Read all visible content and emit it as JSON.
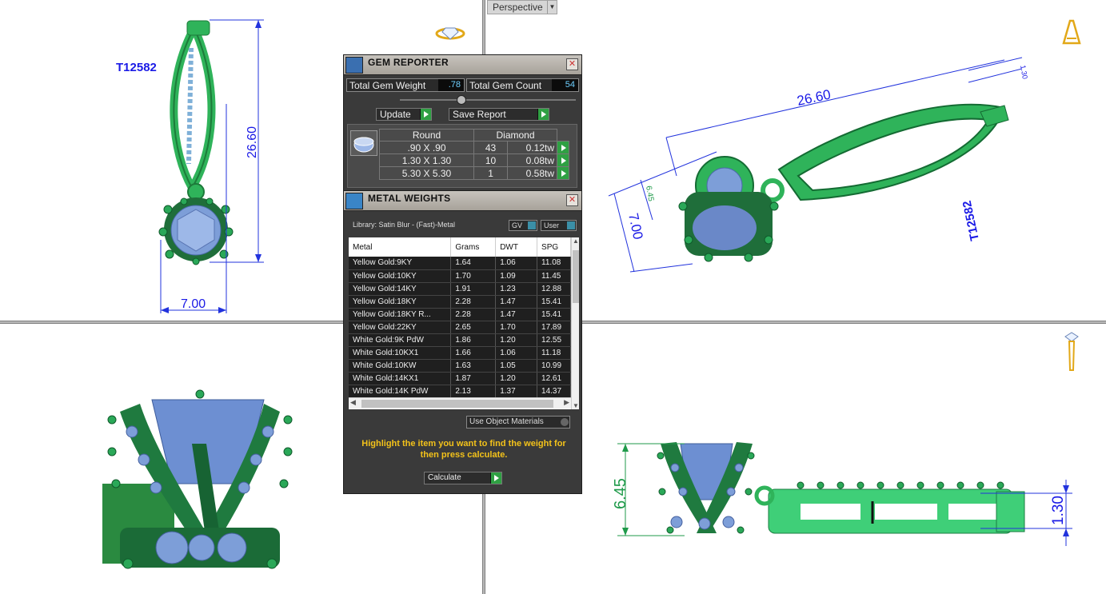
{
  "viewports": {
    "perspective_label": "Perspective",
    "top_left": {
      "part_label": "T12582",
      "dim_height": "26.60",
      "dim_width": "7.00"
    },
    "top_right": {
      "dim_length": "26.60",
      "dim_small": "1.30",
      "dim_small2": "6.45",
      "dim_width": "7.00",
      "engraving": "T12582"
    },
    "bottom_right": {
      "dim_height": "6.45",
      "dim_thickness": "1.30"
    }
  },
  "gem_reporter": {
    "title": "GEM REPORTER",
    "total_weight_label": "Total Gem Weight",
    "total_weight_value": ".78",
    "total_count_label": "Total Gem Count",
    "total_count_value": "54",
    "update_label": "Update",
    "save_label": "Save Report",
    "shape_header": "Round",
    "material_header": "Diamond",
    "rows": [
      {
        "size": ".90 X .90",
        "count": "43",
        "weight": "0.12tw"
      },
      {
        "size": "1.30 X 1.30",
        "count": "10",
        "weight": "0.08tw"
      },
      {
        "size": "5.30 X 5.30",
        "count": "1",
        "weight": "0.58tw"
      }
    ]
  },
  "metal_weights": {
    "title": "METAL WEIGHTS",
    "library_label": "Library: Satin Blur - (Fast)-Metal",
    "gv_label": "GV",
    "user_label": "User",
    "columns": [
      "Metal",
      "Grams",
      "DWT",
      "SPG"
    ],
    "rows": [
      [
        "Yellow Gold:9KY",
        "1.64",
        "1.06",
        "11.08"
      ],
      [
        "Yellow Gold:10KY",
        "1.70",
        "1.09",
        "11.45"
      ],
      [
        "Yellow Gold:14KY",
        "1.91",
        "1.23",
        "12.88"
      ],
      [
        "Yellow Gold:18KY",
        "2.28",
        "1.47",
        "15.41"
      ],
      [
        "Yellow Gold:18KY R...",
        "2.28",
        "1.47",
        "15.41"
      ],
      [
        "Yellow Gold:22KY",
        "2.65",
        "1.70",
        "17.89"
      ],
      [
        "White Gold:9K PdW",
        "1.86",
        "1.20",
        "12.55"
      ],
      [
        "White Gold:10KX1",
        "1.66",
        "1.06",
        "11.18"
      ],
      [
        "White Gold:10KW",
        "1.63",
        "1.05",
        "10.99"
      ],
      [
        "White Gold:14KX1",
        "1.87",
        "1.20",
        "12.61"
      ],
      [
        "White Gold:14K PdW",
        "2.13",
        "1.37",
        "14.37"
      ]
    ],
    "use_object_materials": "Use Object Materials",
    "hint": "Highlight the item you want to find the weight for then press calculate.",
    "calculate_label": "Calculate"
  }
}
